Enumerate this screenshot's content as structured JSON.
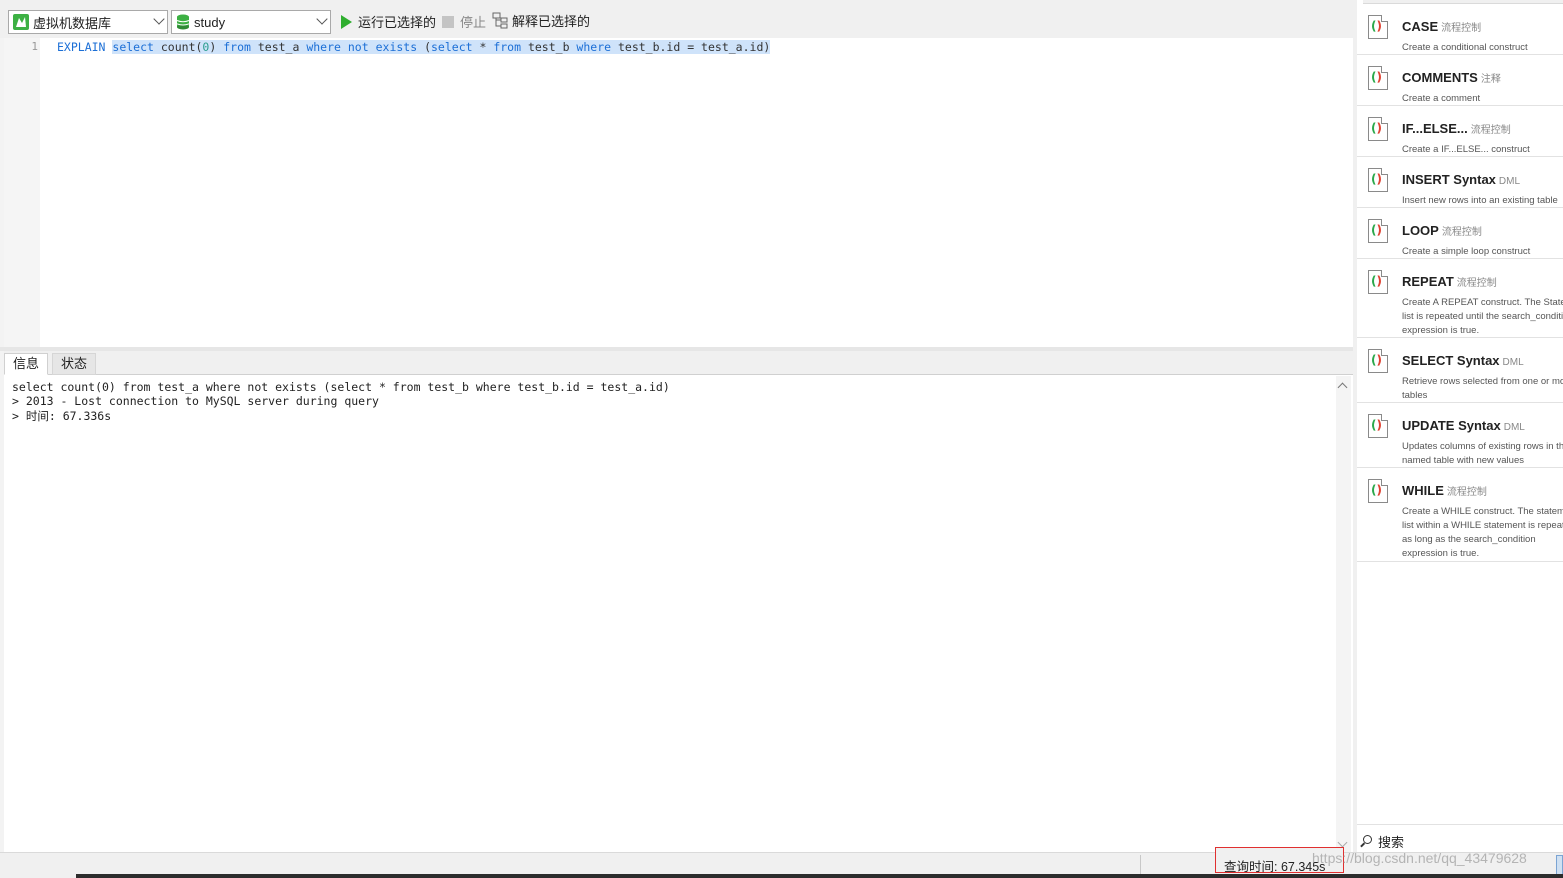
{
  "toolbar": {
    "connection": "虚拟机数据库",
    "database": "study",
    "run_selected": "运行已选择的",
    "stop": "停止",
    "explain_selected": "解释已选择的"
  },
  "editor": {
    "line_number": "1",
    "tokens": [
      {
        "t": "EXPLAIN",
        "c": "kw",
        "s": false
      },
      {
        "t": " ",
        "c": "plain",
        "s": false
      },
      {
        "t": "select",
        "c": "kw",
        "s": true
      },
      {
        "t": " count(",
        "c": "plain",
        "s": true
      },
      {
        "t": "0",
        "c": "num",
        "s": true
      },
      {
        "t": ") ",
        "c": "plain",
        "s": true
      },
      {
        "t": "from",
        "c": "kw",
        "s": true
      },
      {
        "t": " test_a ",
        "c": "plain",
        "s": true
      },
      {
        "t": "where",
        "c": "kw",
        "s": true
      },
      {
        "t": " ",
        "c": "plain",
        "s": true
      },
      {
        "t": "not",
        "c": "kw",
        "s": true
      },
      {
        "t": " ",
        "c": "plain",
        "s": true
      },
      {
        "t": "exists",
        "c": "kw",
        "s": true
      },
      {
        "t": " (",
        "c": "plain",
        "s": true
      },
      {
        "t": "select",
        "c": "kw",
        "s": true
      },
      {
        "t": " * ",
        "c": "plain",
        "s": true
      },
      {
        "t": "from",
        "c": "kw",
        "s": true
      },
      {
        "t": " test_b ",
        "c": "plain",
        "s": true
      },
      {
        "t": "where",
        "c": "kw",
        "s": true
      },
      {
        "t": " test_b.id = test_a.id)",
        "c": "plain",
        "s": true
      }
    ]
  },
  "result_tabs": {
    "info": "信息",
    "status": "状态"
  },
  "output": {
    "line1": "select count(0) from test_a where not exists (select * from test_b where test_b.id = test_a.id)",
    "line2": "> 2013 - Lost connection to MySQL server during query",
    "line3": "> 时间: 67.336s"
  },
  "statusbar": {
    "query_time": "查询时间: 67.345s",
    "watermark": "https://blog.csdn.net/qq_43479628"
  },
  "snippets": [
    {
      "title": "CASE",
      "category": "流程控制",
      "desc": "Create a conditional construct"
    },
    {
      "title": "COMMENTS",
      "category": "注释",
      "desc": "Create a comment"
    },
    {
      "title": "IF...ELSE...",
      "category": "流程控制",
      "desc": "Create a IF...ELSE... construct"
    },
    {
      "title": "INSERT Syntax",
      "category": "DML",
      "desc": "Insert new rows into an existing table"
    },
    {
      "title": "LOOP",
      "category": "流程控制",
      "desc": "Create a simple loop construct"
    },
    {
      "title": "REPEAT",
      "category": "流程控制",
      "desc": "Create A REPEAT construct. The Statement\nlist is repeated until the search_condition\nexpression is true."
    },
    {
      "title": "SELECT Syntax",
      "category": "DML",
      "desc": "Retrieve rows selected from one or more\ntables"
    },
    {
      "title": "UPDATE Syntax",
      "category": "DML",
      "desc": "Updates columns of existing rows in the\nnamed table with new values"
    },
    {
      "title": "WHILE",
      "category": "流程控制",
      "desc": "Create a WHILE construct. The statement\nlist within a WHILE statement is repeated\nas long as the search_condition\nexpression is true."
    }
  ],
  "snippet_search": "搜索",
  "colors": {
    "keyword": "#1c6fd6",
    "selection": "#cfe3fa",
    "run_icon": "#2fae2f",
    "highlight_box": "#e03030"
  }
}
